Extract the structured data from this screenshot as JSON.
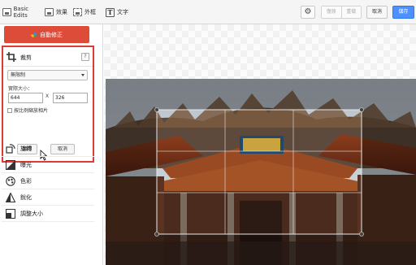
{
  "toolbar": {
    "tabs": [
      {
        "label": "Basic Edits"
      },
      {
        "label": "效果"
      },
      {
        "label": "外框"
      },
      {
        "label": "文字"
      }
    ],
    "undo_label": "復原",
    "redo_label": "重做",
    "cancel_label": "取消",
    "save_label": "儲存"
  },
  "sidebar": {
    "autofix_label": "自動修正",
    "crop": {
      "title": "裁剪",
      "help": "?",
      "ratio_value": "無限制",
      "size_label": "實際大小：",
      "width_value": "644",
      "times": "X",
      "height_value": "326",
      "aspect_label": "按比例縮放相片",
      "apply_label": "套用",
      "cancel_label": "取消"
    },
    "tools": [
      {
        "label": "旋轉"
      },
      {
        "label": "曝光"
      },
      {
        "label": "色彩"
      },
      {
        "label": "銳化"
      },
      {
        "label": "調整大小"
      }
    ]
  },
  "colors": {
    "accent_red": "#dd4b39",
    "save_blue": "#4d90fe",
    "panel_border": "#dd3b34"
  }
}
